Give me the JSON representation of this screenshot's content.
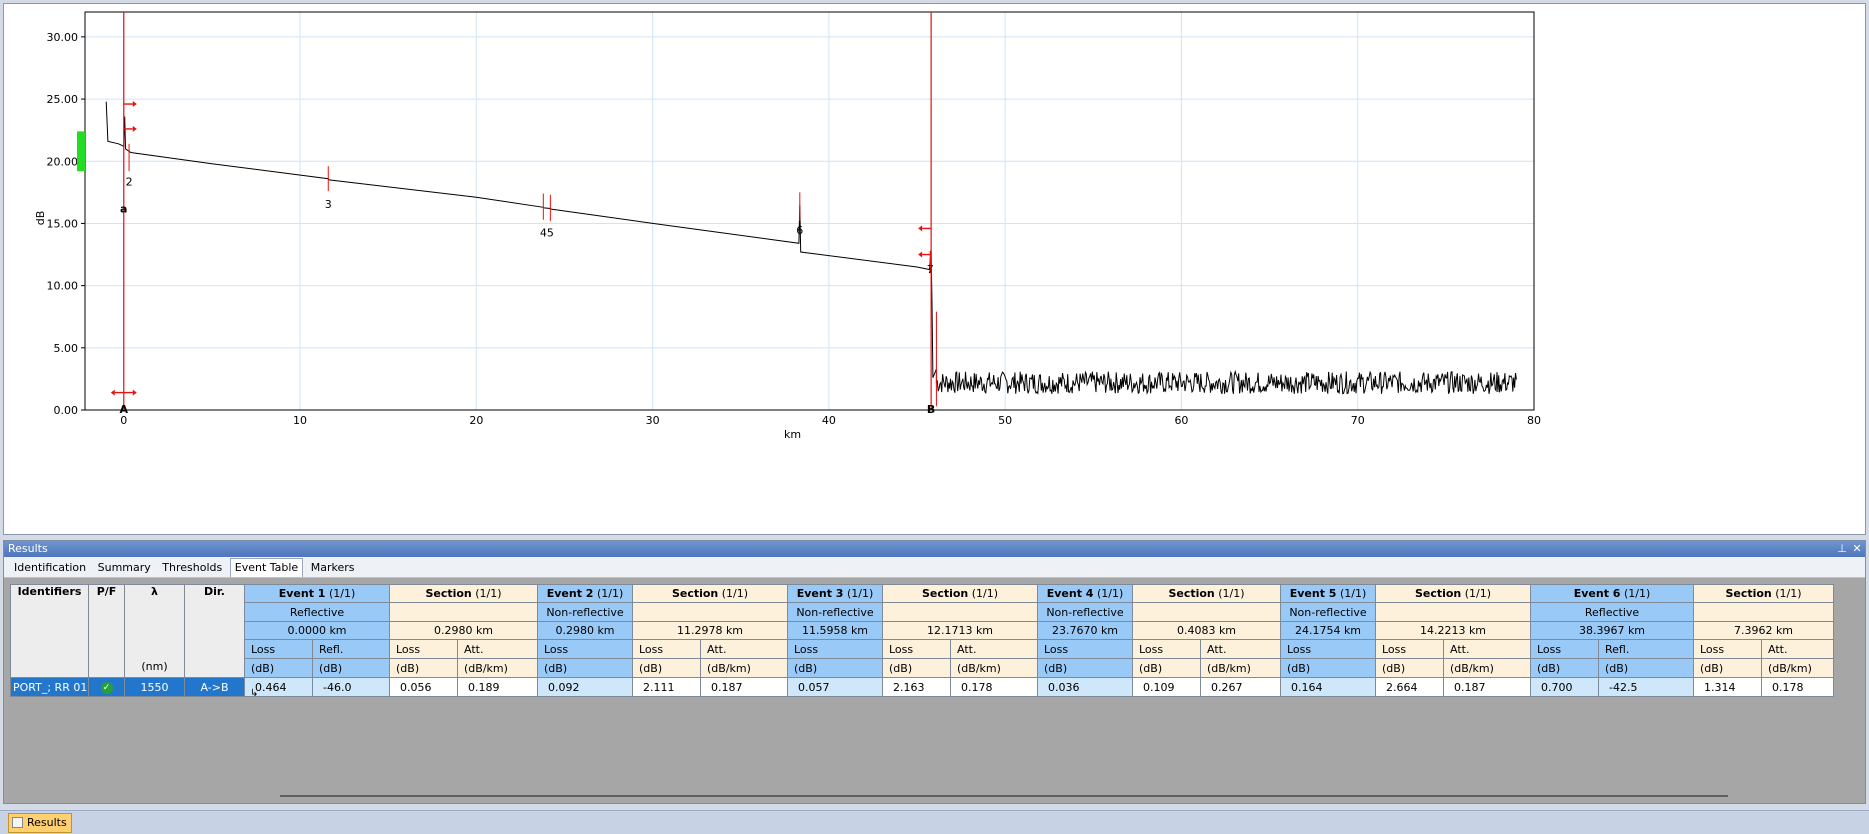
{
  "chart_data": {
    "type": "line",
    "xlabel": "km",
    "ylabel": "dB",
    "xlim": [
      -2.2,
      80
    ],
    "ylim": [
      0,
      32
    ],
    "x_ticks": [
      "0",
      "10",
      "20",
      "30",
      "40",
      "50",
      "60",
      "70",
      "80"
    ],
    "y_ticks": [
      "0.00",
      "5.00",
      "10.00",
      "15.00",
      "20.00",
      "25.00",
      "30.00"
    ],
    "grid": true,
    "series": [
      {
        "points": [
          [
            -1.0,
            24.8
          ],
          [
            -0.9,
            21.6
          ],
          [
            -0.3,
            21.4
          ],
          [
            0.0,
            21.2
          ],
          [
            0.05,
            23.6
          ],
          [
            0.1,
            21.0
          ],
          [
            0.3,
            20.8
          ],
          [
            0.4,
            20.7
          ],
          [
            5,
            19.8
          ],
          [
            11.6,
            18.6
          ],
          [
            11.65,
            18.5
          ],
          [
            20,
            17.1
          ],
          [
            23.8,
            16.3
          ],
          [
            23.85,
            16.25
          ],
          [
            24.2,
            16.2
          ],
          [
            24.25,
            16.15
          ],
          [
            30,
            15.0
          ],
          [
            38.3,
            13.4
          ],
          [
            38.35,
            16.5
          ],
          [
            38.4,
            12.7
          ],
          [
            45,
            11.5
          ],
          [
            45.7,
            11.3
          ],
          [
            45.8,
            12.9
          ],
          [
            45.85,
            8.6
          ],
          [
            45.9,
            2.6
          ],
          [
            46.1,
            3.3
          ]
        ],
        "noise_from_x": 46.1,
        "noise_to_x": 79.0,
        "noise_center": 2.2,
        "noise_amplitude": 0.9
      }
    ],
    "event_markers": [
      {
        "x": 0.3,
        "label": "2",
        "y_top": 21.4,
        "y_bot": 19.2,
        "label_y": 19.0
      },
      {
        "x": 11.6,
        "label": "3",
        "y_top": 19.6,
        "y_bot": 17.6,
        "label_y": 17.2
      },
      {
        "x": 23.8,
        "label": "4",
        "y_top": 17.4,
        "y_bot": 15.3,
        "label_y": 14.9
      },
      {
        "x": 24.2,
        "label": "5",
        "y_top": 17.3,
        "y_bot": 15.2,
        "label_y": 14.9
      },
      {
        "x": 38.35,
        "label": "6",
        "y_top": 17.5,
        "y_bot": 15.2,
        "label_y": 15.1
      },
      {
        "x": 45.75,
        "label": "7",
        "y_top": 12.8,
        "y_bot": 11.0,
        "label_y": 12.0
      },
      {
        "x": 46.1,
        "label": "",
        "y_top": 7.9,
        "y_bot": 0.3,
        "label_y": 0
      }
    ],
    "cursors": [
      {
        "x": 0.0,
        "label": "A",
        "sublabel": "a"
      },
      {
        "x": 45.8,
        "label": "B",
        "sublabel": ""
      }
    ],
    "arrows": [
      {
        "x": 0.0,
        "y": 24.6,
        "dir": "right"
      },
      {
        "x": 0.0,
        "y": 22.6,
        "dir": "right"
      },
      {
        "x": 45.8,
        "y": 14.6,
        "dir": "left"
      },
      {
        "x": 45.8,
        "y": 12.5,
        "dir": "left"
      },
      {
        "x": 0.0,
        "y": 1.4,
        "dir": "both"
      }
    ],
    "colors": {
      "trace": "#000000",
      "marker": "#e81010",
      "grid": "#cfe4f5",
      "level": "#22dd22"
    },
    "level_band": [
      19.2,
      22.4
    ]
  },
  "results": {
    "title": "Results",
    "pin_icon": "pin-icon",
    "close_icon": "close-icon",
    "tabs": [
      "Identification",
      "Summary",
      "Thresholds",
      "Event Table",
      "Markers"
    ],
    "active_tab": "Event Table"
  },
  "table": {
    "id_headers": {
      "identifiers": "Identifiers",
      "pf": "P/F",
      "lambda": "λ",
      "dir": "Dir.",
      "nm": "(nm)"
    },
    "groups": [
      {
        "kind": "event",
        "name": "Event 1",
        "count": "(1/1)",
        "type": "Reflective",
        "distance": "0.0000 km",
        "col1": "Loss",
        "col2": "Refl.",
        "unit1": "(dB)",
        "unit2": "(dB)",
        "val1": "0.464",
        "val2": "-46.0"
      },
      {
        "kind": "section",
        "name": "Section",
        "count": "(1/1)",
        "type": "",
        "distance": "0.2980 km",
        "col1": "Loss",
        "col2": "Att.",
        "unit1": "(dB)",
        "unit2": "(dB/km)",
        "val1": "0.056",
        "val2": "0.189"
      },
      {
        "kind": "event",
        "name": "Event 2",
        "count": "(1/1)",
        "type": "Non-reflective",
        "distance": "0.2980 km",
        "col1": "Loss",
        "col2": "",
        "unit1": "(dB)",
        "unit2": "",
        "val1": "0.092",
        "val2": ""
      },
      {
        "kind": "section",
        "name": "Section",
        "count": "(1/1)",
        "type": "",
        "distance": "11.2978 km",
        "col1": "Loss",
        "col2": "Att.",
        "unit1": "(dB)",
        "unit2": "(dB/km)",
        "val1": "2.111",
        "val2": "0.187"
      },
      {
        "kind": "event",
        "name": "Event 3",
        "count": "(1/1)",
        "type": "Non-reflective",
        "distance": "11.5958 km",
        "col1": "Loss",
        "col2": "",
        "unit1": "(dB)",
        "unit2": "",
        "val1": "0.057",
        "val2": ""
      },
      {
        "kind": "section",
        "name": "Section",
        "count": "(1/1)",
        "type": "",
        "distance": "12.1713 km",
        "col1": "Loss",
        "col2": "Att.",
        "unit1": "(dB)",
        "unit2": "(dB/km)",
        "val1": "2.163",
        "val2": "0.178"
      },
      {
        "kind": "event",
        "name": "Event 4",
        "count": "(1/1)",
        "type": "Non-reflective",
        "distance": "23.7670 km",
        "col1": "Loss",
        "col2": "",
        "unit1": "(dB)",
        "unit2": "",
        "val1": "0.036",
        "val2": ""
      },
      {
        "kind": "section",
        "name": "Section",
        "count": "(1/1)",
        "type": "",
        "distance": "0.4083 km",
        "col1": "Loss",
        "col2": "Att.",
        "unit1": "(dB)",
        "unit2": "(dB/km)",
        "val1": "0.109",
        "val2": "0.267"
      },
      {
        "kind": "event",
        "name": "Event 5",
        "count": "(1/1)",
        "type": "Non-reflective",
        "distance": "24.1754 km",
        "col1": "Loss",
        "col2": "",
        "unit1": "(dB)",
        "unit2": "",
        "val1": "0.164",
        "val2": ""
      },
      {
        "kind": "section",
        "name": "Section",
        "count": "(1/1)",
        "type": "",
        "distance": "14.2213 km",
        "col1": "Loss",
        "col2": "Att.",
        "unit1": "(dB)",
        "unit2": "(dB/km)",
        "val1": "2.664",
        "val2": "0.187"
      },
      {
        "kind": "event",
        "name": "Event 6",
        "count": "(1/1)",
        "type": "Reflective",
        "distance": "38.3967 km",
        "col1": "Loss",
        "col2": "Refl.",
        "unit1": "(dB)",
        "unit2": "(dB)",
        "val1": "0.700",
        "val2": "-42.5"
      },
      {
        "kind": "section",
        "name": "Section",
        "count": "(1/1)",
        "type": "",
        "distance": "7.3962 km",
        "col1": "Loss",
        "col2": "Att.",
        "unit1": "(dB)",
        "unit2": "(dB/km)",
        "val1": "1.314",
        "val2": "0.178"
      }
    ],
    "row": {
      "identifier": "PORT_; RR 01",
      "pf_icon": "pass-check-icon",
      "lambda": "1550",
      "dir": "A->B",
      "row_marker_icon": "row-arrow-icon"
    }
  },
  "bottom_tab": {
    "label": "Results",
    "icon": "results-window-icon"
  }
}
